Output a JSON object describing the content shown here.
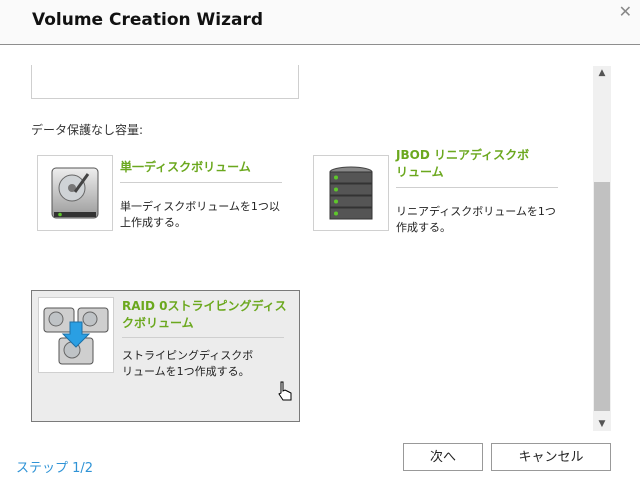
{
  "window": {
    "title": "Volume Creation Wizard",
    "close_glyph": "✕"
  },
  "section": {
    "label": "データ保護なし容量:"
  },
  "options": [
    {
      "title_line1": "単一ディスクボリューム",
      "title_line2": "",
      "desc_line1": "単一ディスクボリュームを1つ以",
      "desc_line2": "上作成する。",
      "icon": "hard-drive-icon"
    },
    {
      "title_line1": "JBOD リニアディスクボ",
      "title_line2": "リューム",
      "desc_line1": "リニアディスクボリュームを1つ",
      "desc_line2": "作成する。",
      "icon": "disk-stack-icon"
    },
    {
      "title_line1": "RAID 0ストライピングディス",
      "title_line2": "クボリューム",
      "desc_line1": "ストライピングディスクボ",
      "desc_line2": "リュームを1つ作成する。",
      "icon": "striped-drives-icon",
      "selected": true
    }
  ],
  "footer": {
    "step": "ステップ 1/2",
    "next_label": "次へ",
    "cancel_label": "キャンセル"
  },
  "colors": {
    "accent_green": "#6ba81e",
    "step_blue": "#2f93d6"
  }
}
